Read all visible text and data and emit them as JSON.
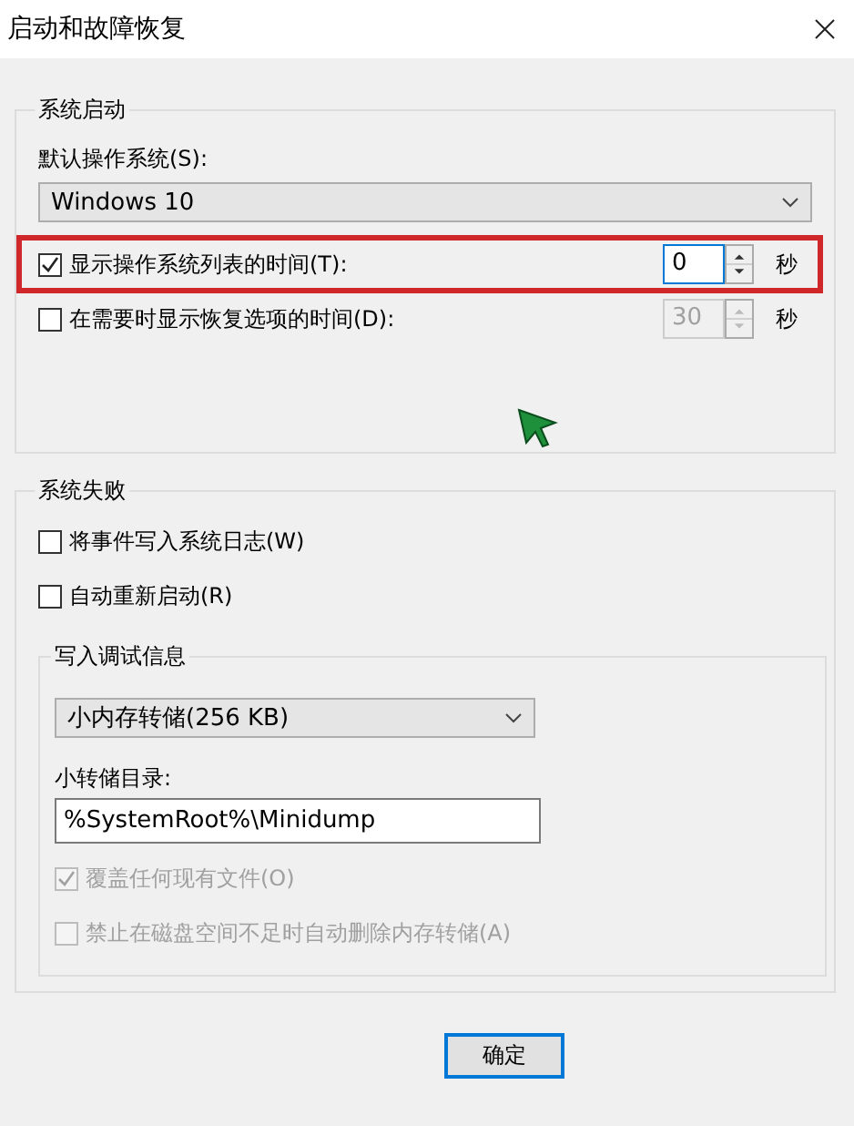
{
  "window": {
    "title": "启动和故障恢复"
  },
  "system_startup": {
    "title": "系统启动",
    "default_os_label": "默认操作系统(S):",
    "default_os": "Windows 10",
    "rows": [
      {
        "label": "显示操作系统列表的时间(T):",
        "checked": true,
        "value": "0",
        "unit": "秒",
        "disabled": false,
        "focused": true,
        "highlighted": true
      },
      {
        "label": "在需要时显示恢复选项的时间(D):",
        "checked": false,
        "value": "30",
        "unit": "秒",
        "disabled": true,
        "focused": false,
        "highlighted": false
      }
    ]
  },
  "system_failure": {
    "title": "系统失败",
    "options": [
      {
        "label": "将事件写入系统日志(W)",
        "checked": false,
        "disabled": false
      },
      {
        "label": "自动重新启动(R)",
        "checked": false,
        "disabled": false
      }
    ],
    "debug_info": {
      "title": "写入调试信息",
      "dump_type": "小内存转储(256 KB)",
      "dump_dir_label": "小转储目录:",
      "dump_dir": "%SystemRoot%\\Minidump",
      "options": [
        {
          "label": "覆盖任何现有文件(O)",
          "checked": true,
          "disabled": true
        },
        {
          "label": "禁止在磁盘空间不足时自动删除内存转储(A)",
          "checked": false,
          "disabled": true
        }
      ]
    }
  },
  "buttons": [
    {
      "label": "确定"
    }
  ]
}
